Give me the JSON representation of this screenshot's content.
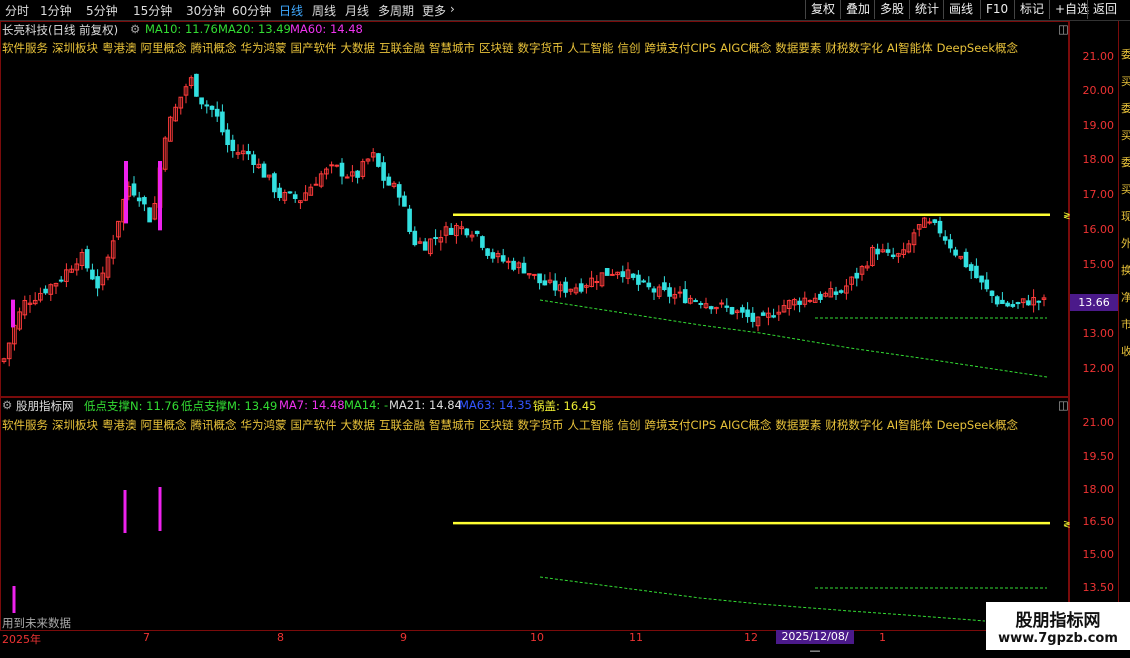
{
  "toolbar": {
    "periods": [
      "分时",
      "1分钟",
      "5分钟",
      "15分钟",
      "30分钟",
      "60分钟",
      "日线",
      "周线",
      "月线",
      "多周期",
      "更多"
    ],
    "active_period": "日线",
    "right_buttons": [
      "复权",
      "叠加",
      "多股",
      "统计",
      "画线",
      "F10",
      "标记",
      "+自选",
      "返回"
    ]
  },
  "main_panel": {
    "stock_title": "长亮科技(日线 前复权)",
    "ma_values": [
      {
        "label": "MA10: 11.76",
        "color": "#33dd33"
      },
      {
        "label": "MA20: 13.49",
        "color": "#33dd33"
      },
      {
        "label": "MA60: 14.48",
        "color": "#ee33ee"
      }
    ],
    "y_ticks": [
      "21.00",
      "20.00",
      "19.00",
      "18.00",
      "17.00",
      "16.00",
      "15.00",
      "14.00",
      "13.00",
      "12.00"
    ],
    "last_price": "13.66"
  },
  "concepts": [
    "软件服务",
    "深圳板块",
    "粤港澳",
    "阿里概念",
    "腾讯概念",
    "华为鸿蒙",
    "国产软件",
    "大数据",
    "互联金融",
    "智慧城市",
    "区块链",
    "数字货币",
    "人工智能",
    "信创",
    "跨境支付CIPS",
    "AIGC概念",
    "数据要素",
    "财税数字化",
    "AI智能体",
    "DeepSeek概念"
  ],
  "indicator_panel": {
    "name": "股朋指标网",
    "values": [
      {
        "label": "低点支撑N: 11.76",
        "color": "#33dd33"
      },
      {
        "label": "低点支撑M: 13.49",
        "color": "#33dd33"
      },
      {
        "label": "MA7: 14.48",
        "color": "#ee33ee"
      },
      {
        "label": "MA14: -",
        "color": "#33dd33"
      },
      {
        "label": "MA21: 14.84",
        "color": "#dddddd"
      },
      {
        "label": "MA63: 14.35",
        "color": "#3355ff"
      },
      {
        "label": "锅盖: 16.45",
        "color": "#eeee33"
      }
    ],
    "y_ticks": [
      "21.00",
      "19.50",
      "18.00",
      "16.50",
      "15.00",
      "13.50"
    ],
    "future_note": "用到未来数据"
  },
  "x_axis": {
    "labels": [
      "2025年",
      "7",
      "8",
      "9",
      "10",
      "11",
      "12",
      "1"
    ],
    "cursor_date": "2025/12/08/—"
  },
  "side_text": [
    "委",
    "买",
    "委",
    "买",
    "委",
    "买",
    "现",
    "外",
    "换",
    "净",
    "市",
    "收"
  ],
  "watermark": {
    "line1": "股朋指标网",
    "line2": "www.7gpzb.com"
  },
  "colors": {
    "up": "#ff3b3b",
    "down": "#33e0e0",
    "yellow": "#ffff33",
    "magenta": "#ee22ee",
    "green_dash": "#33dd33"
  }
}
